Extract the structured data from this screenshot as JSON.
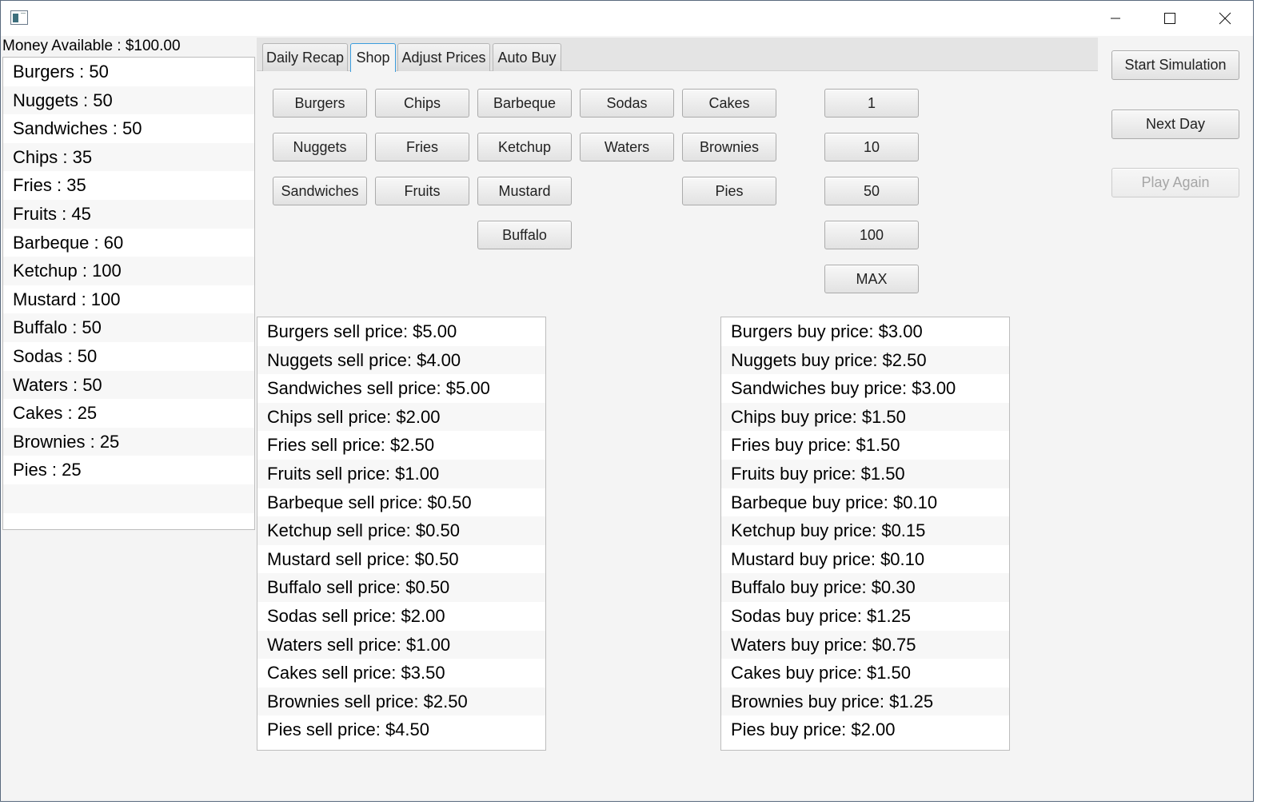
{
  "window": {
    "minimize_icon": "minimize-icon",
    "maximize_icon": "maximize-icon",
    "close_icon": "close-icon"
  },
  "money": "Money Available : $100.00",
  "inventory": [
    "Burgers : 50",
    "Nuggets : 50",
    "Sandwiches : 50",
    "Chips : 35",
    "Fries : 35",
    "Fruits : 45",
    "Barbeque : 60",
    "Ketchup : 100",
    "Mustard : 100",
    "Buffalo : 50",
    "Sodas : 50",
    "Waters : 50",
    "Cakes : 25",
    "Brownies : 25",
    "Pies : 25"
  ],
  "tabs": [
    "Daily Recap",
    "Shop",
    "Adjust Prices",
    "Auto Buy"
  ],
  "active_tab": "Shop",
  "shop": {
    "items": {
      "burgers": "Burgers",
      "chips": "Chips",
      "barbeque": "Barbeque",
      "sodas": "Sodas",
      "cakes": "Cakes",
      "nuggets": "Nuggets",
      "fries": "Fries",
      "ketchup": "Ketchup",
      "waters": "Waters",
      "brownies": "Brownies",
      "sandwiches": "Sandwiches",
      "fruits": "Fruits",
      "mustard": "Mustard",
      "pies": "Pies",
      "buffalo": "Buffalo"
    },
    "quantities": [
      "1",
      "10",
      "50",
      "100",
      "MAX"
    ]
  },
  "controls": {
    "start": "Start Simulation",
    "next_day": "Next Day",
    "play_again": "Play Again"
  },
  "sell_prices": [
    "Burgers sell price: $5.00",
    "Nuggets sell price: $4.00",
    "Sandwiches sell price: $5.00",
    "Chips sell price: $2.00",
    "Fries sell price: $2.50",
    "Fruits sell price: $1.00",
    "Barbeque sell price: $0.50",
    "Ketchup sell price: $0.50",
    "Mustard sell price: $0.50",
    "Buffalo sell price: $0.50",
    "Sodas sell price: $2.00",
    "Waters sell price: $1.00",
    "Cakes sell price: $3.50",
    "Brownies sell price: $2.50",
    "Pies sell price: $4.50"
  ],
  "buy_prices": [
    "Burgers buy price: $3.00",
    "Nuggets buy price: $2.50",
    "Sandwiches buy price: $3.00",
    "Chips buy price: $1.50",
    "Fries buy price: $1.50",
    "Fruits buy price: $1.50",
    "Barbeque buy price: $0.10",
    "Ketchup buy price: $0.15",
    "Mustard buy price: $0.10",
    "Buffalo buy price: $0.30",
    "Sodas buy price: $1.25",
    "Waters buy price: $0.75",
    "Cakes buy price: $1.50",
    "Brownies buy price: $1.25",
    "Pies buy price: $2.00"
  ]
}
